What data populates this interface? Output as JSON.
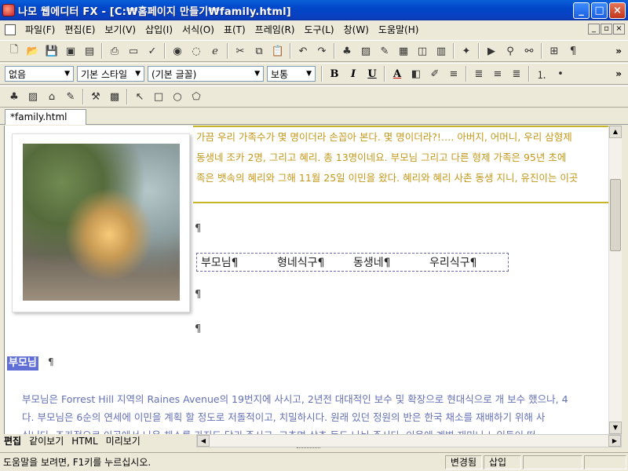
{
  "window": {
    "title": "나모 웹에디터 FX - [C:₩홈페이지 만들기₩family.html]"
  },
  "menu": [
    "파일(F)",
    "편집(E)",
    "보기(V)",
    "삽입(I)",
    "서식(O)",
    "표(T)",
    "프레임(R)",
    "도구(L)",
    "창(W)",
    "도움말(H)"
  ],
  "format_bar": {
    "paragraph_style": "없음",
    "style": "기본 스타일",
    "font": "(기본 글꼴)",
    "size": "보통"
  },
  "document_tab": "*family.html",
  "page": {
    "intro_lines": [
      "가끔 우리 가족수가 몇 명이더라 손꼽아 본다. 몇 명이더라?!…. 아버지, 어머니, 우리 삼형제",
      "동생네 조카 2명, 그리고 혜리. 총 13명이네요. 부모님 그리고 다른 형제 가족은 95년 초에",
      "족은 뱃속의 혜리와 그해 11월 25일 이민을 왔다. 혜리와 혜리 사촌 동생 지니, 유진이는 이곳"
    ],
    "nav_links": [
      "부모님¶",
      "형네식구¶",
      "동생네¶",
      "우리식구¶"
    ],
    "pilcrow": "¶",
    "section_heading": "부모님",
    "body_lines": [
      "부모님은 Forrest Hill 지역의 Raines Avenue의 19번지에 사시고, 2년전 대대적인 보수 및 확장으로 현대식으로 개 보수 했으나, 4",
      "다. 부모님은 6순의 연세에 이민을 계획 할 정도로 저돌적이고, 치밀하시다. 원래 있던 정원의 반은 한국 채소를 재배하기 위해 사",
      "십니다. 조카정으로 이곳에서 나온 채소를 가지도 담궈 주시고, 고추며 상추 등도 나눠 주시다. 이웃에 계변 재미나 노인들이 떠"
    ]
  },
  "view_tabs": [
    "편집",
    "같이보기",
    "HTML",
    "미리보기"
  ],
  "status": {
    "message": "도움말을 보려면, F1키를 누르십시오.",
    "modified": "변경됨",
    "mode": "삽입"
  }
}
